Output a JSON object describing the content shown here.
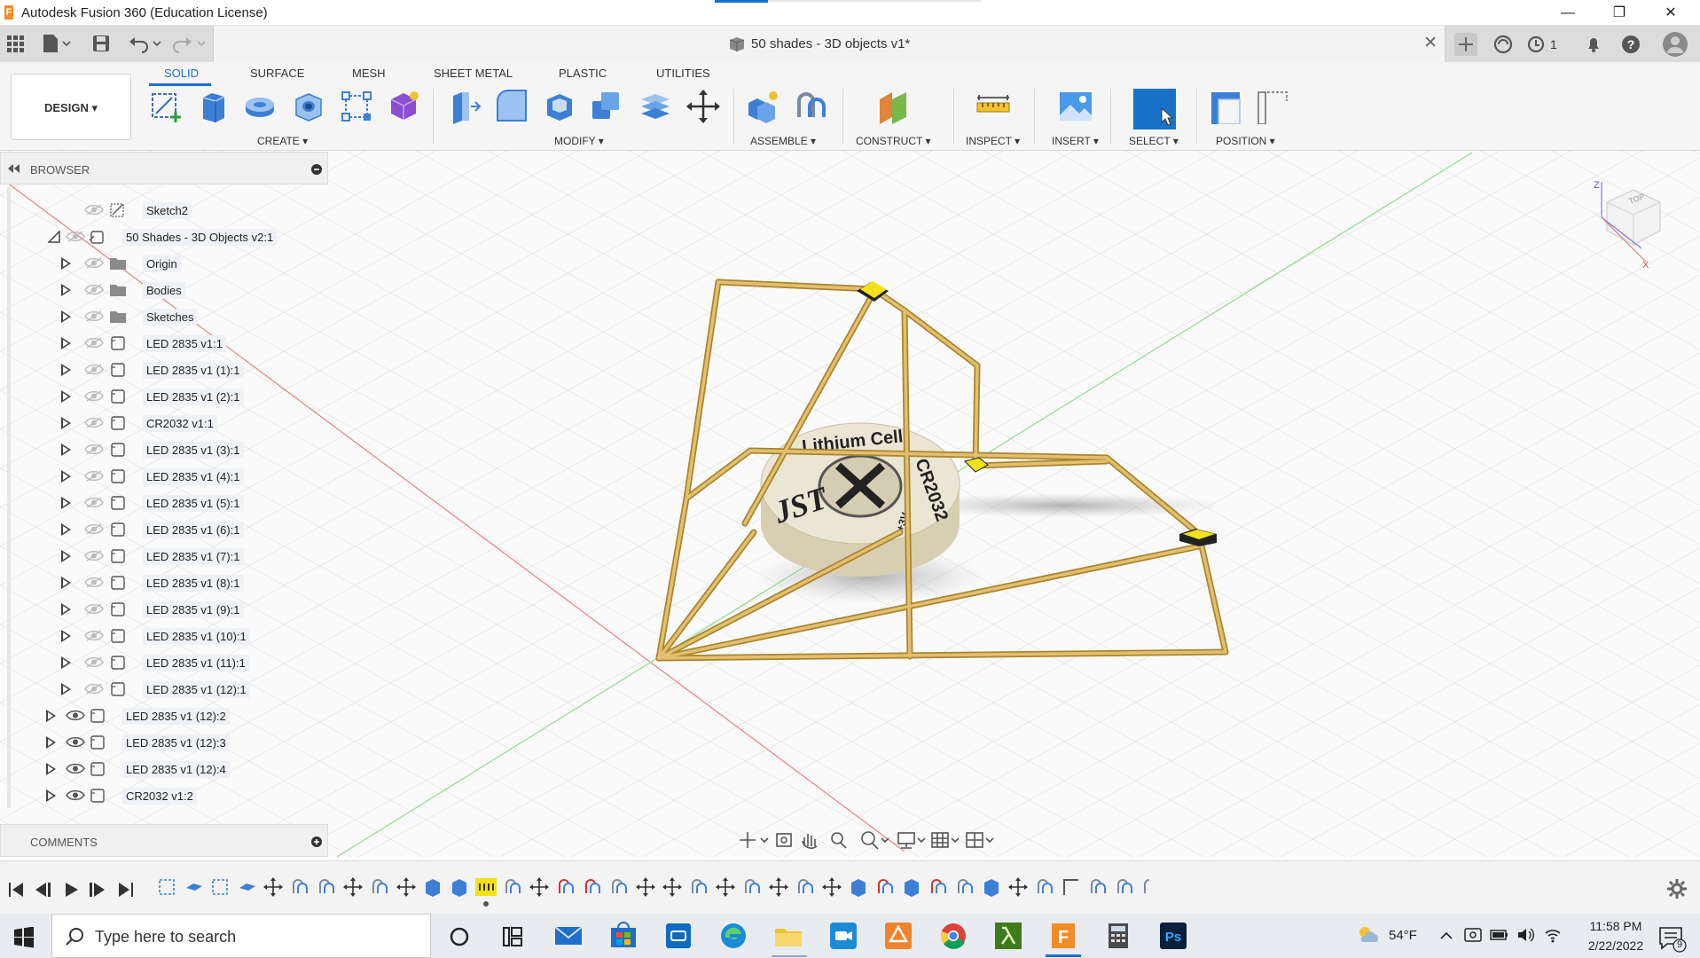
{
  "window": {
    "title": "Autodesk Fusion 360 (Education License)",
    "minimize_glyph": "—",
    "restore_glyph": "❐",
    "close_glyph": "✕"
  },
  "document": {
    "title": "50 shades - 3D objects v1*",
    "close_glyph": "✕",
    "job_count": "1"
  },
  "workspace": {
    "label": "DESIGN ▾"
  },
  "ribbon": {
    "tabs": [
      "SOLID",
      "SURFACE",
      "MESH",
      "SHEET METAL",
      "PLASTIC",
      "UTILITIES"
    ],
    "active_tab": "SOLID",
    "groups": {
      "create": "CREATE ▾",
      "modify": "MODIFY ▾",
      "assemble": "ASSEMBLE ▾",
      "construct": "CONSTRUCT ▾",
      "inspect": "INSPECT ▾",
      "insert": "INSERT ▾",
      "select": "SELECT ▾",
      "position": "POSITION ▾"
    }
  },
  "browser": {
    "title": "BROWSER",
    "items": [
      {
        "label": "Sketch2",
        "icon": "sketch-icon",
        "indent": 2,
        "visible": false,
        "expander": false
      },
      {
        "label": "50 Shades - 3D Objects v2:1",
        "icon": "component-link-icon",
        "indent": 1,
        "visible": false,
        "expander": "open"
      },
      {
        "label": "Origin",
        "icon": "folder-icon",
        "indent": 2,
        "visible": false,
        "expander": true
      },
      {
        "label": "Bodies",
        "icon": "folder-icon",
        "indent": 2,
        "visible": false,
        "expander": true
      },
      {
        "label": "Sketches",
        "icon": "folder-icon",
        "indent": 2,
        "visible": false,
        "expander": true
      },
      {
        "label": "LED 2835 v1:1",
        "icon": "component-icon",
        "indent": 2,
        "visible": false,
        "expander": true
      },
      {
        "label": "LED 2835 v1 (1):1",
        "icon": "component-icon",
        "indent": 2,
        "visible": false,
        "expander": true
      },
      {
        "label": "LED 2835 v1 (2):1",
        "icon": "component-icon",
        "indent": 2,
        "visible": false,
        "expander": true
      },
      {
        "label": "CR2032 v1:1",
        "icon": "component-icon",
        "indent": 2,
        "visible": false,
        "expander": true
      },
      {
        "label": "LED 2835 v1 (3):1",
        "icon": "component-icon",
        "indent": 2,
        "visible": false,
        "expander": true
      },
      {
        "label": "LED 2835 v1 (4):1",
        "icon": "component-icon",
        "indent": 2,
        "visible": false,
        "expander": true
      },
      {
        "label": "LED 2835 v1 (5):1",
        "icon": "component-icon",
        "indent": 2,
        "visible": false,
        "expander": true
      },
      {
        "label": "LED 2835 v1 (6):1",
        "icon": "component-icon",
        "indent": 2,
        "visible": false,
        "expander": true
      },
      {
        "label": "LED 2835 v1 (7):1",
        "icon": "component-icon",
        "indent": 2,
        "visible": false,
        "expander": true
      },
      {
        "label": "LED 2835 v1 (8):1",
        "icon": "component-icon",
        "indent": 2,
        "visible": false,
        "expander": true
      },
      {
        "label": "LED 2835 v1 (9):1",
        "icon": "component-icon",
        "indent": 2,
        "visible": false,
        "expander": true
      },
      {
        "label": "LED 2835 v1 (10):1",
        "icon": "component-icon",
        "indent": 2,
        "visible": false,
        "expander": true
      },
      {
        "label": "LED 2835 v1 (11):1",
        "icon": "component-icon",
        "indent": 2,
        "visible": false,
        "expander": true
      },
      {
        "label": "LED 2835 v1 (12):1",
        "icon": "component-icon",
        "indent": 2,
        "visible": false,
        "expander": true
      },
      {
        "label": "LED 2835 v1 (12):2",
        "icon": "component-icon",
        "indent": 1,
        "visible": true,
        "expander": true
      },
      {
        "label": "LED 2835 v1 (12):3",
        "icon": "component-icon",
        "indent": 1,
        "visible": true,
        "expander": true
      },
      {
        "label": "LED 2835 v1 (12):4",
        "icon": "component-icon",
        "indent": 1,
        "visible": true,
        "expander": true
      },
      {
        "label": "CR2032 v1:2",
        "icon": "component-icon",
        "indent": 1,
        "visible": true,
        "expander": true
      }
    ]
  },
  "comments": {
    "title": "COMMENTS"
  },
  "viewcube": {
    "label": "TOP",
    "axes": [
      "Z",
      "X"
    ]
  },
  "model": {
    "battery_text_top": "Lithium Cell",
    "battery_text_side": "CR2032",
    "battery_logo": "JST",
    "battery_small": "+3V"
  },
  "taskbar": {
    "search_placeholder": "Type here to search",
    "weather": "54°F",
    "time": "11:58 PM",
    "date": "2/22/2022",
    "notifications": "9"
  },
  "colors": {
    "accent": "#1a72c7",
    "wood": "#d9b25b",
    "led": "#f2e11a",
    "grid": "#c9c9c9",
    "axis_x": "#e88080",
    "axis_y": "#7fd67f"
  }
}
